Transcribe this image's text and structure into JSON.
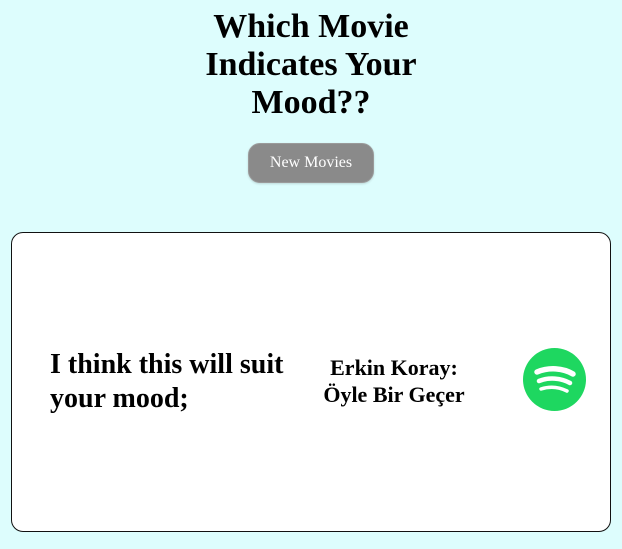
{
  "header": {
    "title_lines": [
      "Which Movie",
      "Indicates Your",
      "Mood??"
    ]
  },
  "actions": {
    "new_movies_label": "New Movies"
  },
  "card": {
    "suggestion_text": "I think this will suit your mood;",
    "song_artist": "Erkin Koray:",
    "song_title": "Öyle Bir Geçer",
    "spotify_icon": "spotify-icon"
  },
  "colors": {
    "background": "#ddfdfd",
    "button": "#8a8a8a",
    "spotify_green": "#1ed760"
  }
}
